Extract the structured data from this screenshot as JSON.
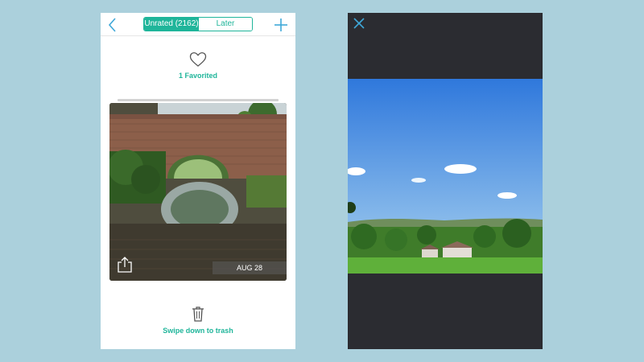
{
  "left_screen": {
    "nav": {
      "back_icon": "chevron-left-icon",
      "add_icon": "plus-icon",
      "tabs": [
        {
          "label": "Unrated (2162)",
          "active": true
        },
        {
          "label": "Later",
          "active": false
        }
      ]
    },
    "favorites": {
      "icon": "heart-outline-icon",
      "label": "1 Favorited"
    },
    "photo": {
      "date": "AUG 28",
      "share_icon": "share-icon"
    },
    "trash": {
      "icon": "trash-icon",
      "label": "Swipe down to trash"
    }
  },
  "right_screen": {
    "close_icon": "close-icon"
  },
  "colors": {
    "accent": "#1fb59a",
    "icon_blue": "#3fa8d8",
    "background": "#abd0dc",
    "viewer_background": "#2b2c31"
  }
}
